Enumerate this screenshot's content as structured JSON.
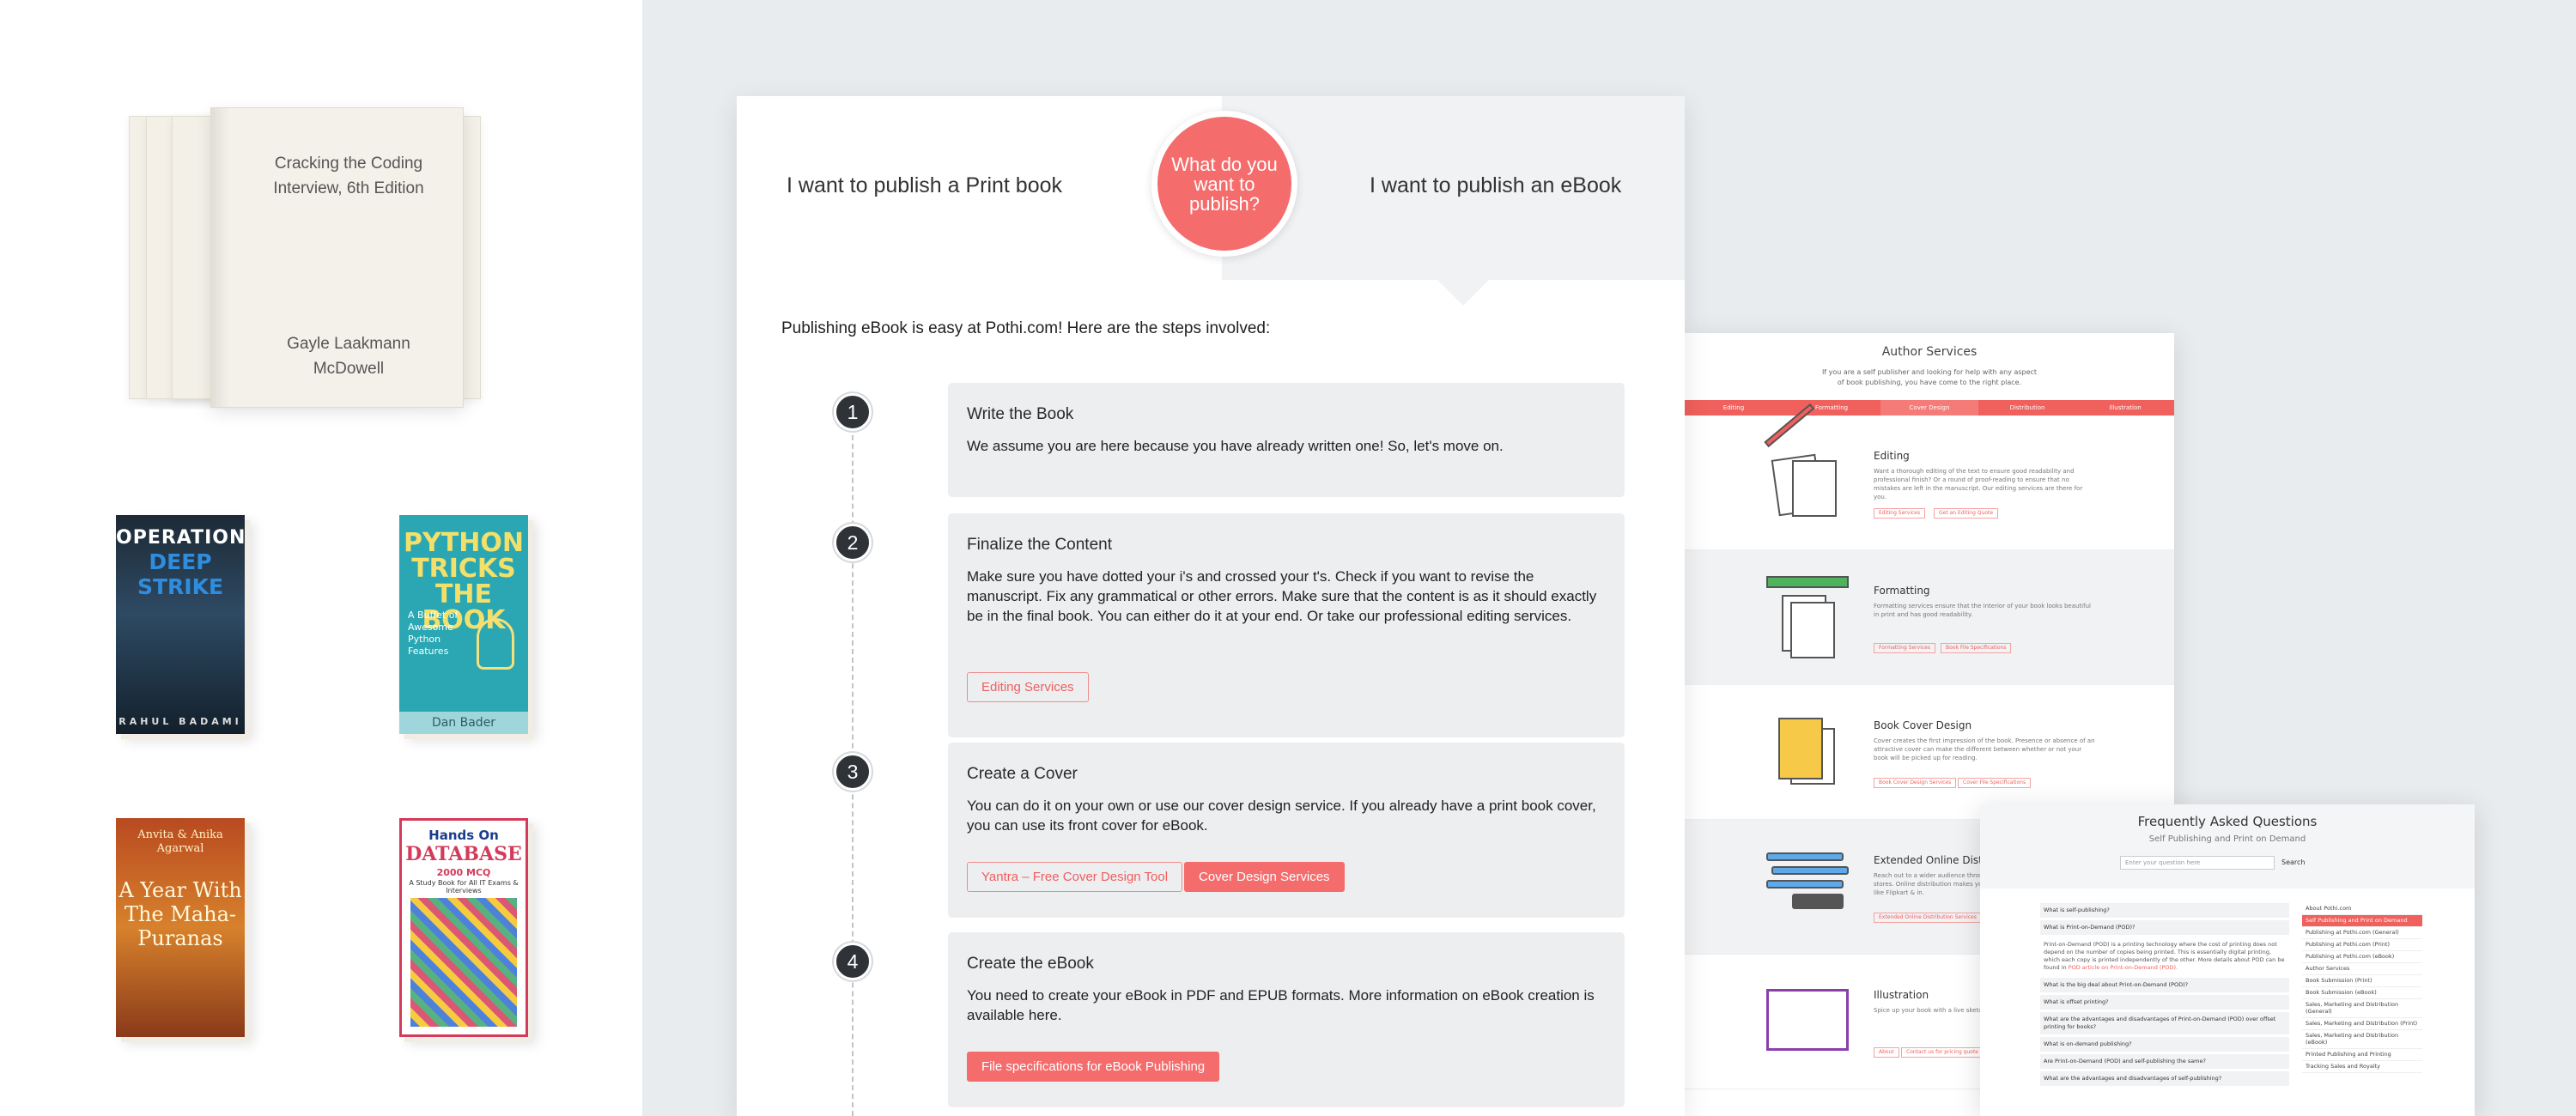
{
  "shelf": {
    "open_book": {
      "title": "Cracking the Coding Interview, 6th Edition",
      "author": "Gayle Laakmann McDowell"
    },
    "books": [
      {
        "line1": "OPERATION",
        "line2": "DEEP STRIKE",
        "author": "RAHUL BADAMI"
      },
      {
        "line1": "PYTHON TRICKS THE BOOK",
        "subtitle": "A Buffet of Awesome Python Features",
        "author": "Dan Bader"
      },
      {
        "line1": "Anvita & Anika Agarwal",
        "line2": "A Year With The Maha-Puranas"
      },
      {
        "line1": "Hands On",
        "line2": "DATABASE",
        "line3": "2000 MCQ",
        "line4": "A Study Book for All IT Exams & Interviews"
      }
    ]
  },
  "card": {
    "tab_print": "I want to publish a Print book",
    "tab_ebook": "I want to publish an eBook",
    "circle_question": "What do you want to publish?",
    "intro": "Publishing eBook is easy at Pothi.com! Here are the steps involved:",
    "steps": [
      {
        "num": "1",
        "title": "Write the Book",
        "text": "We assume you are here because you have already written one! So, let's move on."
      },
      {
        "num": "2",
        "title": "Finalize the Content",
        "text": "Make sure you have dotted your i's and crossed your t's. Check if you want to revise the manuscript. Fix any grammatical or other errors. Make sure that the content is as it should exactly be in the final book. You can either do it at your end. Or take our professional editing services.",
        "buttons": [
          "Editing Services"
        ]
      },
      {
        "num": "3",
        "title": "Create a Cover",
        "text": "You can do it on your own or use our cover design service. If you already have a print book cover, you can use its front cover for eBook.",
        "buttons": [
          "Yantra – Free Cover Design Tool",
          "Cover Design Services"
        ]
      },
      {
        "num": "4",
        "title": "Create the eBook",
        "text": "You need to create your eBook in PDF and EPUB formats. More information on eBook creation is available here.",
        "buttons": [
          "File specifications for eBook Publishing"
        ]
      }
    ]
  },
  "services": {
    "title": "Author Services",
    "subtitle": "If you are a self publisher and looking for help with any aspect of book publishing, you have come to the right place.",
    "nav": [
      "Editing",
      "Formatting",
      "Cover Design",
      "Distribution",
      "Illustration"
    ],
    "rows": [
      {
        "name": "Editing",
        "desc": "Want a thorough editing of the text to ensure good readability and professional finish? Or a round of proof-reading to ensure that no mistakes are left in the manuscript. Our editing services are there for you.",
        "buttons": [
          "Editing Services",
          "Get an Editing Quote"
        ]
      },
      {
        "name": "Formatting",
        "desc": "Formatting services ensure that the interior of your book looks beautiful in print and has good readability.",
        "buttons": [
          "Formatting Services",
          "Book File Specifications"
        ]
      },
      {
        "name": "Book Cover Design",
        "desc": "Cover creates the first impression of the book. Presence or absence of an attractive cover can make the different between whether or not your book will be picked up for reading.",
        "buttons": [
          "Book Cover Design Services",
          "Cover File Specifications"
        ]
      },
      {
        "name": "Extended Online Distribution",
        "desc": "Reach out to a wider audience through Flipkart, Amazon and other online stores. Online distribution makes your book easily available to readers like Flipkart & in.",
        "buttons": [
          "Extended Online Distribution Services"
        ]
      },
      {
        "name": "Illustration",
        "desc": "Spice up your book with a live sketch or illustration.",
        "buttons": [
          "About",
          "Contact us for pricing quote"
        ]
      }
    ]
  },
  "faq": {
    "title": "Frequently Asked Questions",
    "subtitle": "Self Publishing and Print on Demand",
    "search_placeholder": "Enter your question here",
    "search_button": "Search",
    "questions": [
      "What is self-publishing?",
      "What is Print-on-Demand (POD)?",
      "What is the big deal about Print-on-Demand (POD)?",
      "What is offset printing?",
      "What are the advantages and disadvantages of Print-on-Demand (POD) over offset printing for books?",
      "What is on-demand publishing?",
      "Are Print-on-Demand (POD) and self-publishing the same?",
      "What are the advantages and disadvantages of self-publishing?"
    ],
    "answer": "Print-on-Demand (POD) is a printing technology where the cost of printing does not depend on the number of copies being printed. This is essentially digital printing, which each copy is printed independently of the other. More details about POD can be found in",
    "answer_link": "POD article on Print-on-Demand (POD).",
    "categories": [
      "About Pothi.com",
      "Self Publishing and Print on Demand",
      "Publishing at Pothi.com (General)",
      "Publishing at Pothi.com (Print)",
      "Publishing at Pothi.com (eBook)",
      "Author Services",
      "Book Submission (Print)",
      "Book Submission (eBook)",
      "Sales, Marketing and Distribution (General)",
      "Sales, Marketing and Distribution (Print)",
      "Sales, Marketing and Distribution (eBook)",
      "Printed Publishing and Printing",
      "Tracking Sales and Royalty"
    ]
  }
}
